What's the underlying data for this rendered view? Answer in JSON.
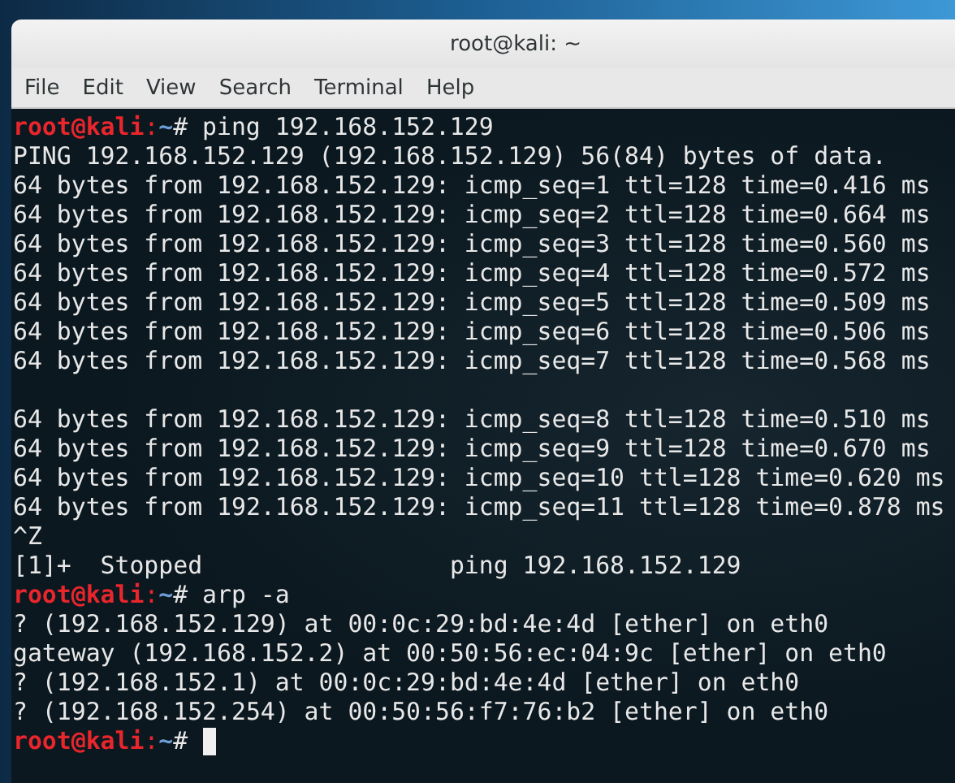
{
  "window": {
    "title": "root@kali: ~"
  },
  "menu": [
    "File",
    "Edit",
    "View",
    "Search",
    "Terminal",
    "Help"
  ],
  "terminal": {
    "lines": [
      {
        "kind": "prompt",
        "user": "root@kali",
        "separator": ":",
        "path": "~",
        "symbol": "#",
        "command": "ping 192.168.152.129"
      },
      {
        "kind": "output",
        "text": "PING 192.168.152.129 (192.168.152.129) 56(84) bytes of data."
      },
      {
        "kind": "output",
        "text": "64 bytes from 192.168.152.129: icmp_seq=1 ttl=128 time=0.416 ms"
      },
      {
        "kind": "output",
        "text": "64 bytes from 192.168.152.129: icmp_seq=2 ttl=128 time=0.664 ms"
      },
      {
        "kind": "output",
        "text": "64 bytes from 192.168.152.129: icmp_seq=3 ttl=128 time=0.560 ms"
      },
      {
        "kind": "output",
        "text": "64 bytes from 192.168.152.129: icmp_seq=4 ttl=128 time=0.572 ms"
      },
      {
        "kind": "output",
        "text": "64 bytes from 192.168.152.129: icmp_seq=5 ttl=128 time=0.509 ms"
      },
      {
        "kind": "output",
        "text": "64 bytes from 192.168.152.129: icmp_seq=6 ttl=128 time=0.506 ms"
      },
      {
        "kind": "output",
        "text": "64 bytes from 192.168.152.129: icmp_seq=7 ttl=128 time=0.568 ms"
      },
      {
        "kind": "blank"
      },
      {
        "kind": "output",
        "text": "64 bytes from 192.168.152.129: icmp_seq=8 ttl=128 time=0.510 ms"
      },
      {
        "kind": "output",
        "text": "64 bytes from 192.168.152.129: icmp_seq=9 ttl=128 time=0.670 ms"
      },
      {
        "kind": "output",
        "text": "64 bytes from 192.168.152.129: icmp_seq=10 ttl=128 time=0.620 ms"
      },
      {
        "kind": "output",
        "text": "64 bytes from 192.168.152.129: icmp_seq=11 ttl=128 time=0.878 ms"
      },
      {
        "kind": "output",
        "text": "^Z"
      },
      {
        "kind": "output",
        "text": "[1]+  Stopped                 ping 192.168.152.129"
      },
      {
        "kind": "prompt",
        "user": "root@kali",
        "separator": ":",
        "path": "~",
        "symbol": "#",
        "command": "arp -a"
      },
      {
        "kind": "output",
        "text": "? (192.168.152.129) at 00:0c:29:bd:4e:4d [ether] on eth0"
      },
      {
        "kind": "output",
        "text": "gateway (192.168.152.2) at 00:50:56:ec:04:9c [ether] on eth0"
      },
      {
        "kind": "output",
        "text": "? (192.168.152.1) at 00:0c:29:bd:4e:4d [ether] on eth0"
      },
      {
        "kind": "output",
        "text": "? (192.168.152.254) at 00:50:56:f7:76:b2 [ether] on eth0"
      },
      {
        "kind": "prompt",
        "user": "root@kali",
        "separator": ":",
        "path": "~",
        "symbol": "#",
        "cursor": true
      }
    ]
  }
}
